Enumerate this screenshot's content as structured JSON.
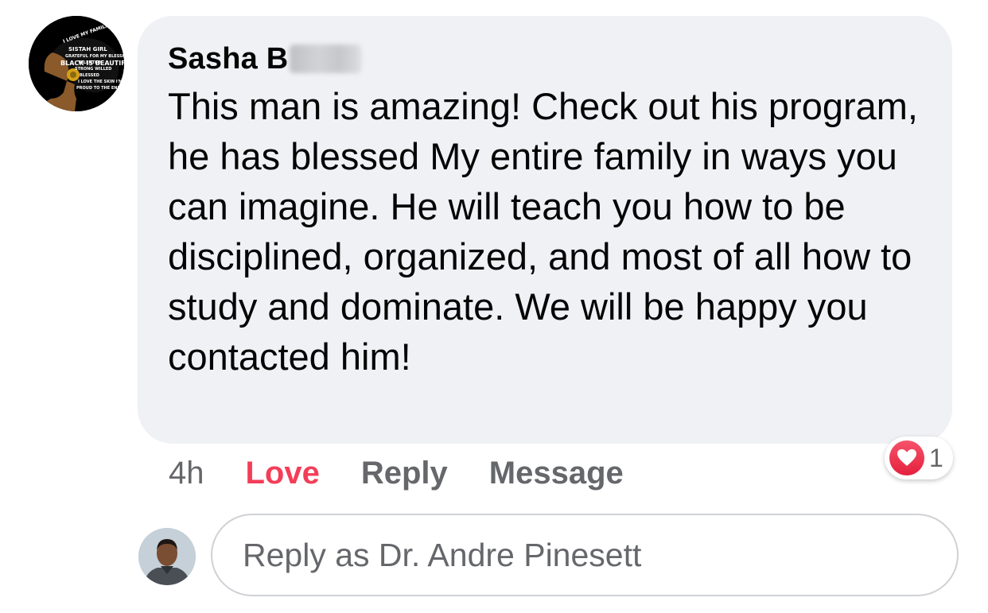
{
  "comment": {
    "author_name": "Sasha B",
    "avatar_text": "BLACK IS BEAUTIFUL",
    "text": "This man is amazing! Check out his program, he has blessed My entire family in ways you can imagine. He will teach you how to be disciplined, organized, and most of all how to study and dominate. We will be happy you contacted him!",
    "reaction": {
      "icon": "heart-icon",
      "count": "1",
      "color": "#f33e58"
    }
  },
  "actions": {
    "time": "4h",
    "love_label": "Love",
    "reply_label": "Reply",
    "message_label": "Message"
  },
  "reply": {
    "placeholder": "Reply as Dr. Andre Pinesett"
  },
  "colors": {
    "bubble_bg": "#f0f1f5",
    "secondary_text": "#65676b",
    "love_red": "#f33e58"
  }
}
